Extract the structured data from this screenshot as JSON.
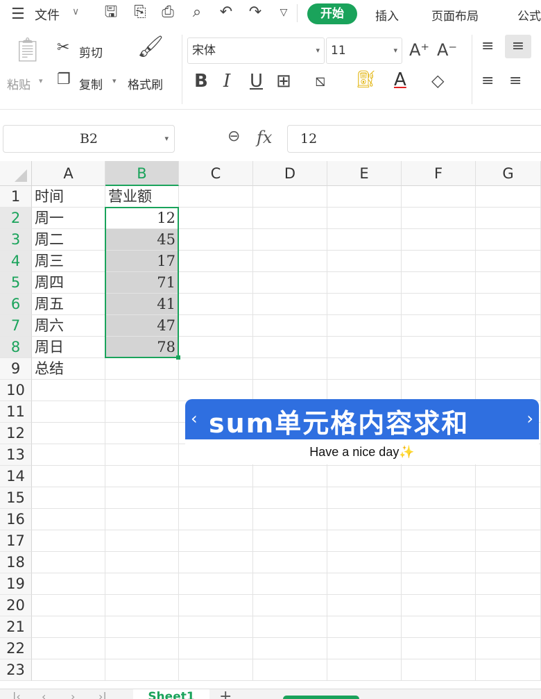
{
  "menu": {
    "file_label": "文件",
    "tabs": [
      {
        "label": "开始",
        "active": true
      },
      {
        "label": "插入",
        "active": false
      },
      {
        "label": "页面布局",
        "active": false
      },
      {
        "label": "公式",
        "active": false
      }
    ]
  },
  "ribbon": {
    "paste_label": "粘贴",
    "cut_label": "剪切",
    "copy_label": "复制",
    "format_painter_label": "格式刷",
    "font_name": "宋体",
    "font_size": "11"
  },
  "formula_bar": {
    "name_box": "B2",
    "formula": "12"
  },
  "grid": {
    "columns": [
      "A",
      "B",
      "C",
      "D",
      "E",
      "F",
      "G"
    ],
    "selected_column": "B",
    "row_numbers": [
      "1",
      "2",
      "3",
      "4",
      "5",
      "6",
      "7",
      "8",
      "9",
      "10",
      "11",
      "12",
      "13",
      "14",
      "15",
      "16",
      "17",
      "18",
      "19",
      "20",
      "21",
      "22",
      "23"
    ],
    "header_row": {
      "A": "时间",
      "B": "营业额"
    },
    "data_rows": [
      {
        "A": "周一",
        "B": "12"
      },
      {
        "A": "周二",
        "B": "45"
      },
      {
        "A": "周三",
        "B": "17"
      },
      {
        "A": "周四",
        "B": "71"
      },
      {
        "A": "周五",
        "B": "41"
      },
      {
        "A": "周六",
        "B": "47"
      },
      {
        "A": "周日",
        "B": "78"
      }
    ],
    "summary_row": {
      "A": "总结"
    }
  },
  "overlay": {
    "title": "sum单元格内容求和",
    "subtitle": "Have a nice day"
  },
  "sheets": {
    "active": "Sheet1"
  },
  "colors": {
    "accent": "#1aa35b",
    "banner": "#2f6fe0",
    "selection_fill": "#d4d4d4"
  }
}
